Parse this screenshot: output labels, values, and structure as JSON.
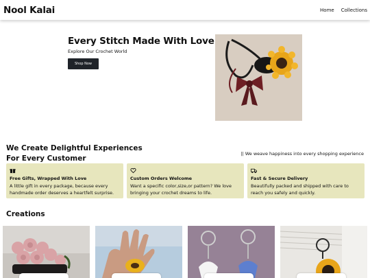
{
  "nav": {
    "brand": "Nool Kalai",
    "links": [
      "Home",
      "Collections"
    ]
  },
  "hero": {
    "title": "Every Stitch Made With Love",
    "subtitle": "Explore Our Crochet World",
    "button_label": "Shop Now"
  },
  "experience": {
    "title_line1": "We Create Delightful Experiences",
    "title_line2": "For Every Customer",
    "quote": "|| We weave happiness into every shopping experience",
    "cards": [
      {
        "icon": "gift-icon",
        "title": "Free Gifts, Wrapped With Love",
        "text": "A little gift in every package, because every handmade order deserves a heartfelt surprise."
      },
      {
        "icon": "heart-icon",
        "title": "Custom Orders Welcome",
        "text": "Want a specific color,size,or pattern? We love bringing your crochet dreams to life."
      },
      {
        "icon": "truck-icon",
        "title": "Fast & Secure Delivery",
        "text": "Beautifully packed and shipped with care to reach you safely and quickly."
      }
    ]
  },
  "creations": {
    "title": "Creations"
  },
  "colors": {
    "card_bg": "#e7e6bd",
    "button_bg": "#1f2329",
    "sunflower": "#e8a51a",
    "maroon": "#6e1f24"
  }
}
